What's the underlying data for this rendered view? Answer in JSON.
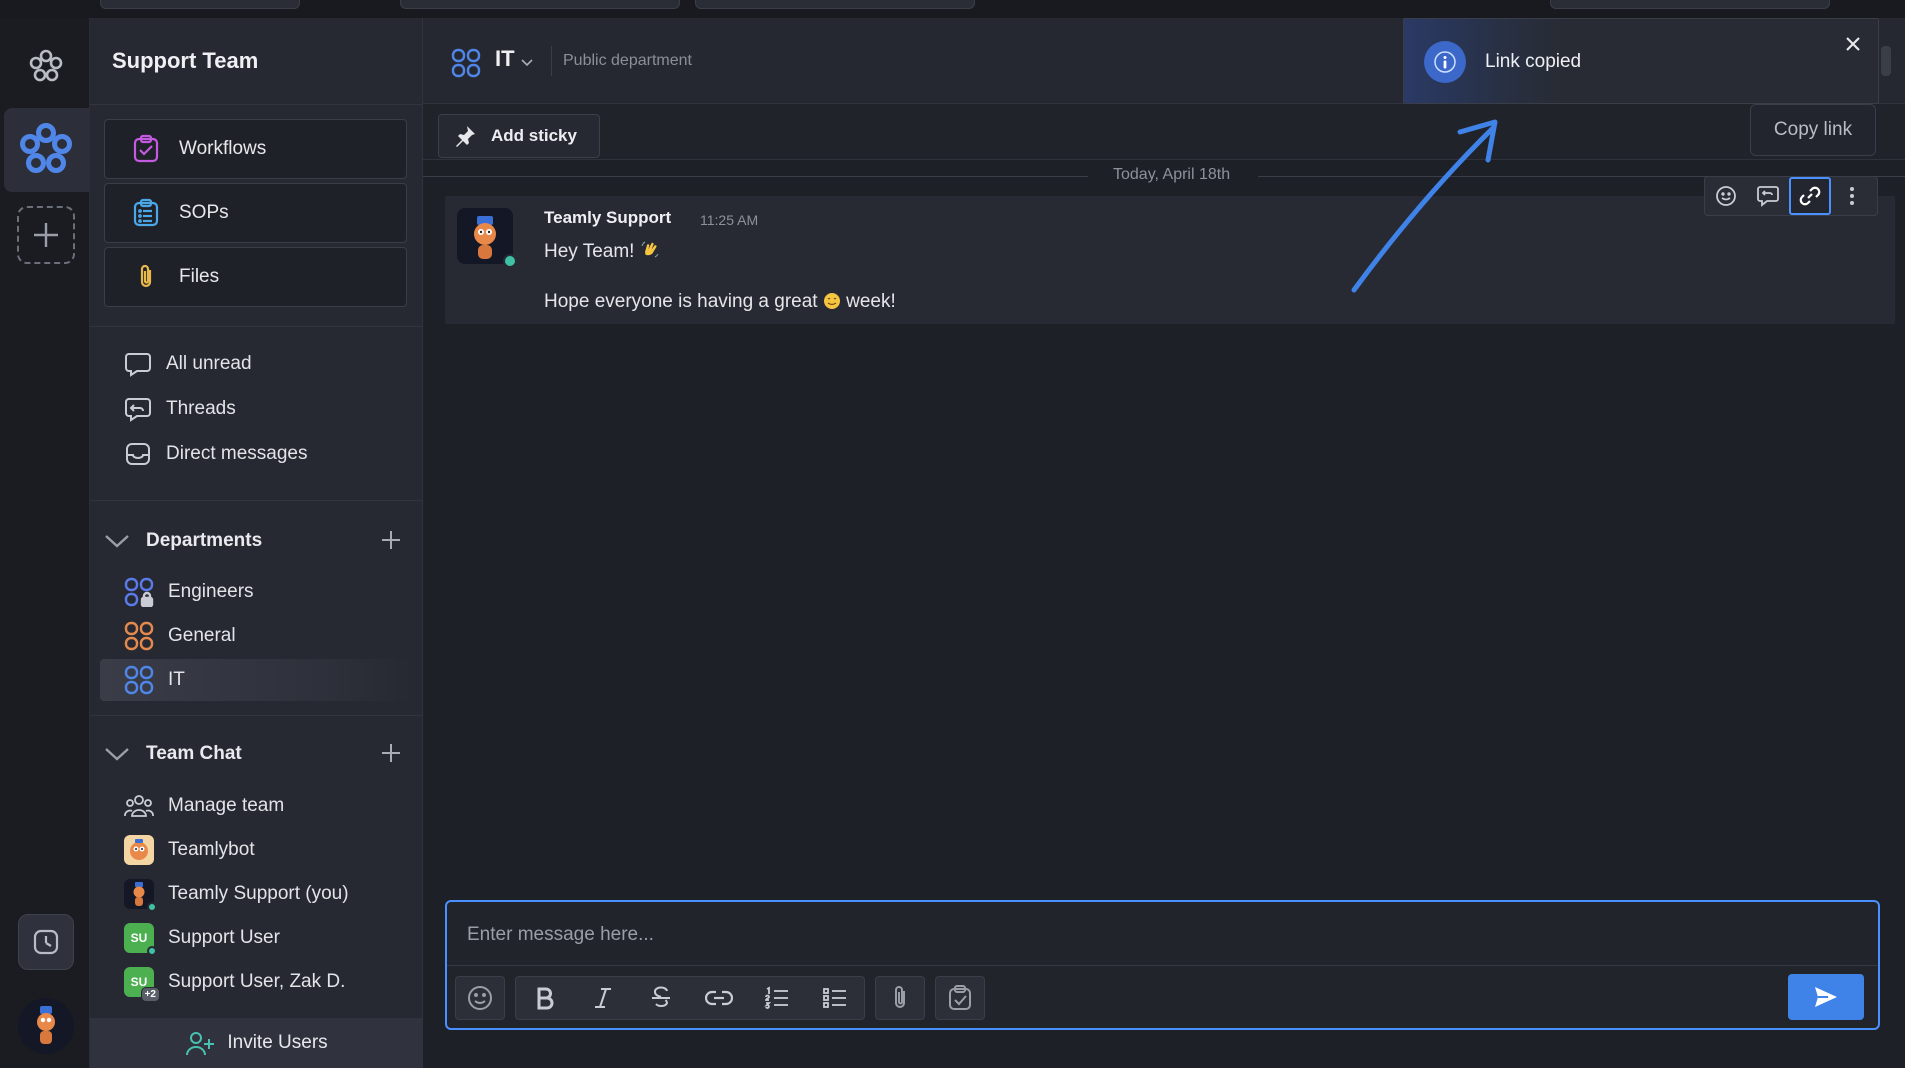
{
  "workspace": {
    "title": "Support Team"
  },
  "sidebar": {
    "quick_buttons": [
      {
        "label": "Workflows",
        "icon": "checklist-icon"
      },
      {
        "label": "SOPs",
        "icon": "clipboard-list-icon"
      },
      {
        "label": "Files",
        "icon": "paperclip-icon"
      }
    ],
    "nav": [
      {
        "label": "All unread",
        "icon": "chat-bubble-icon"
      },
      {
        "label": "Threads",
        "icon": "thread-icon"
      },
      {
        "label": "Direct messages",
        "icon": "inbox-icon"
      }
    ],
    "departments": {
      "title": "Departments",
      "items": [
        {
          "label": "Engineers",
          "color": "#5b7bea"
        },
        {
          "label": "General",
          "color": "#e58a4e"
        },
        {
          "label": "IT",
          "color": "#4f86e8"
        }
      ]
    },
    "team_chat": {
      "title": "Team Chat",
      "items": [
        {
          "label": "Manage team"
        },
        {
          "label": "Teamlybot"
        },
        {
          "label": "Teamly Support (you)"
        },
        {
          "label": "Support User",
          "initials": "SU"
        },
        {
          "label": "Support User, Zak D.",
          "initials": "SU",
          "badge": "+2"
        }
      ]
    },
    "invite_label": "Invite Users"
  },
  "channel": {
    "name": "IT",
    "subtitle": "Public department"
  },
  "toolbar": {
    "add_sticky_label": "Add sticky"
  },
  "date_divider": "Today, April 18th",
  "message": {
    "author": "Teamly Support",
    "time": "11:25 AM",
    "line1": "Hey Team!",
    "line2_before": "Hope everyone is having a great",
    "line2_after": "week!"
  },
  "tooltip": {
    "text": "Copy link"
  },
  "toast": {
    "text": "Link copied"
  },
  "composer": {
    "placeholder": "Enter message here..."
  },
  "colors": {
    "accent": "#4a90ff",
    "online": "#3fc1a5",
    "support_user_green": "#4caf50"
  }
}
